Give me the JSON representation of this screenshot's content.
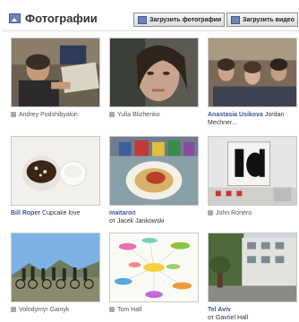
{
  "header": {
    "title": "Фотографии",
    "upload_photos_label": "Загрузить фотографии",
    "upload_video_label": "Загрузить видео"
  },
  "photos": [
    {
      "tag": "Andrey Podshibyakin"
    },
    {
      "tag": "Yulia Blizhenko"
    },
    {
      "name": "Anastasia Usikova",
      "desc": "Jordan",
      "desc2": "Mechner..."
    },
    {
      "name": "Bill Roper",
      "desc": "Cupcake love"
    },
    {
      "name": "maitaron",
      "desc": "от Jacek Jankowski"
    },
    {
      "tag": "John Ronero"
    },
    {
      "tag": "Volodymyr Gainyk"
    },
    {
      "tag": "Tom Hall"
    },
    {
      "name": "Tel Aviv",
      "desc": "от Gavriel Hall"
    }
  ],
  "colors": {
    "link": "#3b5998",
    "border": "#c9c9c9",
    "divider": "#d8dfea"
  },
  "icons": {
    "section": "photo-album-icon",
    "tag": "tag-icon",
    "button": "upload-icon"
  }
}
